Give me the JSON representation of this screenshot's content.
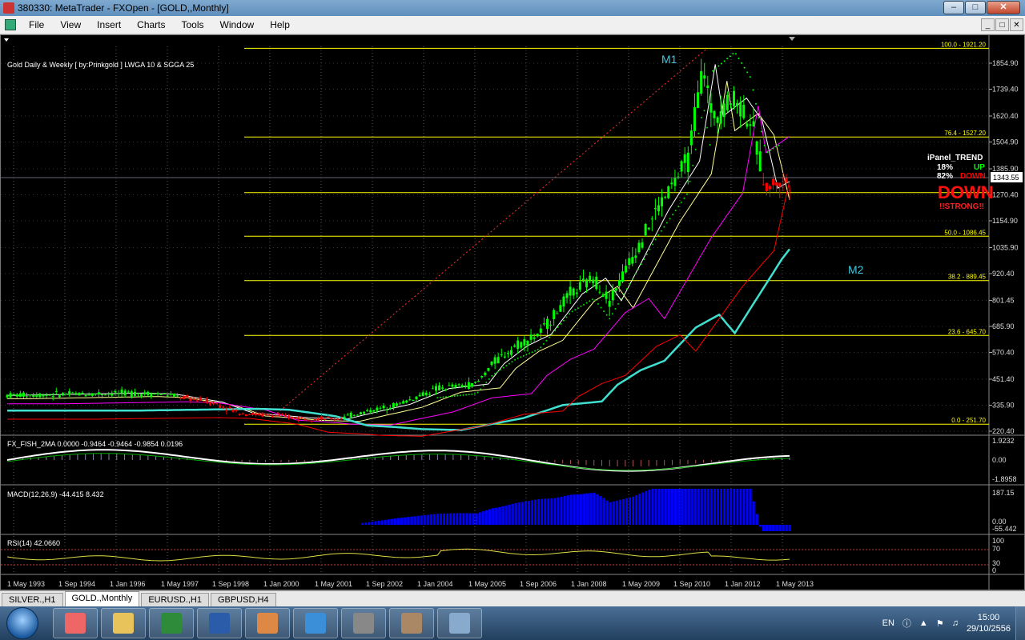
{
  "window": {
    "title": "380330: MetaTrader - FXOpen - [GOLD,,Monthly]",
    "buttons": {
      "minimize": "–",
      "maximize": "□",
      "close": "✕"
    }
  },
  "menu": [
    "File",
    "View",
    "Insert",
    "Charts",
    "Tools",
    "Window",
    "Help"
  ],
  "menu_right_buttons": [
    "_",
    "□",
    "✕"
  ],
  "chart": {
    "info_label": "Gold Daily & Weekly [ by:Prinkgold ]  LWGA 10  &  SGGA 25",
    "annotation_m1": "M1",
    "annotation_m2": "M2",
    "price_axis": [
      "1854.90",
      "1739.40",
      "1620.40",
      "1504.90",
      "1385.90",
      "1270.40",
      "1154.90",
      "1035.90",
      "920.40",
      "801.45",
      "685.90",
      "570.40",
      "451.40",
      "335.90",
      "220.40"
    ],
    "current_price": "1343.55",
    "fib_levels": [
      {
        "label": "100.0 - 1921.20",
        "price": 1921.2
      },
      {
        "label": "76.4 - 1527.20",
        "price": 1527.2
      },
      {
        "label": "",
        "price": 1280.0
      },
      {
        "label": "50.0 - 1086.45",
        "price": 1086.45
      },
      {
        "label": "38.2 - 889.45",
        "price": 889.45
      },
      {
        "label": "23.6 - 645.70",
        "price": 645.7
      },
      {
        "label": "0.0 - 251.70",
        "price": 251.7
      }
    ],
    "ipanel": {
      "title": "iPanel_TREND",
      "up_pct": "18%",
      "up_label": "UP",
      "down_pct": "82%",
      "down_label": "DOWN",
      "big_label": "DOWN",
      "strength": "!!STRONG!!"
    },
    "date_axis": [
      "1 May 1993",
      "1 Sep 1994",
      "1 Jan 1996",
      "1 May 1997",
      "1 Sep 1998",
      "1 Jan 2000",
      "1 May 2001",
      "1 Sep 2002",
      "1 Jan 2004",
      "1 May 2005",
      "1 Sep 2006",
      "1 Jan 2008",
      "1 May 2009",
      "1 Sep 2010",
      "1 Jan 2012",
      "1 May 2013"
    ]
  },
  "indicators": {
    "fisher": {
      "label": "FX_FISH_2MA 0.0000 -0.9464 -0.9464 -0.9854 0.0196",
      "axis": [
        "1.9232",
        "0.00",
        "-1.8958"
      ]
    },
    "macd": {
      "label": "MACD(12,26,9) -44.415 8.432",
      "axis": [
        "187.15",
        "0.00",
        "-55.442"
      ]
    },
    "rsi": {
      "label": "RSI(14) 42.0660",
      "axis": [
        "100",
        "70",
        "30",
        "0"
      ]
    }
  },
  "tabs": [
    {
      "label": "SILVER.,H1",
      "active": false
    },
    {
      "label": "GOLD.,Monthly",
      "active": true
    },
    {
      "label": "EURUSD.,H1",
      "active": false
    },
    {
      "label": "GBPUSD,H4",
      "active": false
    }
  ],
  "taskbar": {
    "apps": [
      {
        "name": "media-player-icon",
        "color": "#e66"
      },
      {
        "name": "folder-icon",
        "color": "#e8c25a"
      },
      {
        "name": "excel-icon",
        "color": "#2e8b3a"
      },
      {
        "name": "word-icon",
        "color": "#2a5caa"
      },
      {
        "name": "chrome-icon",
        "color": "#d84"
      },
      {
        "name": "ie-icon",
        "color": "#3a8fd8"
      },
      {
        "name": "metatrader-icon",
        "color": "#888"
      },
      {
        "name": "gimp-icon",
        "color": "#a86"
      },
      {
        "name": "paint-icon",
        "color": "#8ac"
      }
    ],
    "language": "EN",
    "time": "15:00",
    "date": "29/10/2556"
  },
  "colors": {
    "bull_candle": "#00ff00",
    "bear_candle": "#ff0000",
    "fib": "#ffff00",
    "ma_fast": "#ffffff",
    "ma_mid": "#ffff99",
    "ma_slow": "#ff00ff",
    "ma_long": "#40e0d0",
    "ma_red": "#ff0000",
    "macd_hist": "#0000ff"
  }
}
